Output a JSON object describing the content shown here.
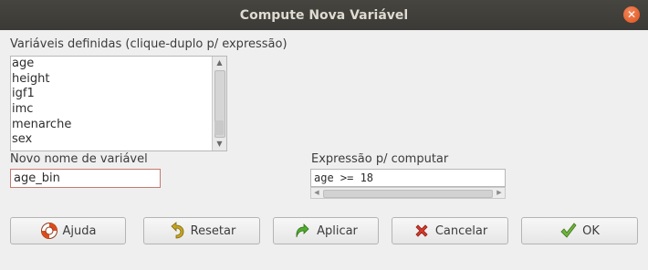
{
  "window": {
    "title": "Compute Nova Variável"
  },
  "variables": {
    "label": "Variáveis definidas (clique-duplo p/ expressão)",
    "items": [
      "age",
      "height",
      "igf1",
      "imc",
      "menarche",
      "sex"
    ]
  },
  "new_name": {
    "label": "Novo nome de variável",
    "value": "age_bin"
  },
  "expression": {
    "label": "Expressão p/ computar",
    "value": "age >= 18"
  },
  "buttons": {
    "help": "Ajuda",
    "reset": "Resetar",
    "apply": "Aplicar",
    "cancel": "Cancelar",
    "ok": "OK"
  },
  "icons": {
    "close": "close-icon",
    "help": "lifebuoy-icon",
    "reset": "undo-arrow-icon",
    "apply": "redo-arrow-icon",
    "cancel": "red-x-icon",
    "ok": "green-check-icon"
  },
  "colors": {
    "titlebar": "#3b3a36",
    "close": "#e0531d",
    "focus_border": "#c57a6f"
  }
}
